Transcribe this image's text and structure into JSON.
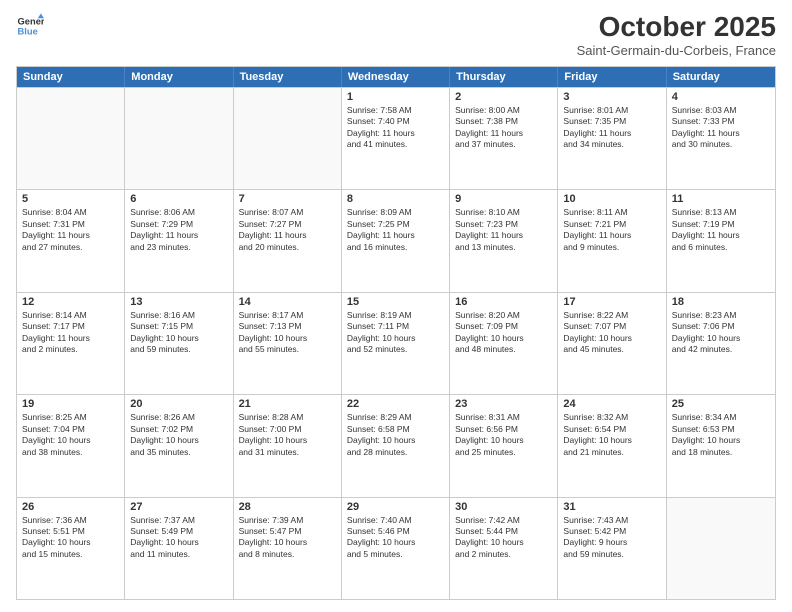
{
  "header": {
    "logo_line1": "General",
    "logo_line2": "Blue",
    "month": "October 2025",
    "location": "Saint-Germain-du-Corbeis, France"
  },
  "weekdays": [
    "Sunday",
    "Monday",
    "Tuesday",
    "Wednesday",
    "Thursday",
    "Friday",
    "Saturday"
  ],
  "rows": [
    [
      {
        "day": "",
        "text": ""
      },
      {
        "day": "",
        "text": ""
      },
      {
        "day": "",
        "text": ""
      },
      {
        "day": "1",
        "text": "Sunrise: 7:58 AM\nSunset: 7:40 PM\nDaylight: 11 hours\nand 41 minutes."
      },
      {
        "day": "2",
        "text": "Sunrise: 8:00 AM\nSunset: 7:38 PM\nDaylight: 11 hours\nand 37 minutes."
      },
      {
        "day": "3",
        "text": "Sunrise: 8:01 AM\nSunset: 7:35 PM\nDaylight: 11 hours\nand 34 minutes."
      },
      {
        "day": "4",
        "text": "Sunrise: 8:03 AM\nSunset: 7:33 PM\nDaylight: 11 hours\nand 30 minutes."
      }
    ],
    [
      {
        "day": "5",
        "text": "Sunrise: 8:04 AM\nSunset: 7:31 PM\nDaylight: 11 hours\nand 27 minutes."
      },
      {
        "day": "6",
        "text": "Sunrise: 8:06 AM\nSunset: 7:29 PM\nDaylight: 11 hours\nand 23 minutes."
      },
      {
        "day": "7",
        "text": "Sunrise: 8:07 AM\nSunset: 7:27 PM\nDaylight: 11 hours\nand 20 minutes."
      },
      {
        "day": "8",
        "text": "Sunrise: 8:09 AM\nSunset: 7:25 PM\nDaylight: 11 hours\nand 16 minutes."
      },
      {
        "day": "9",
        "text": "Sunrise: 8:10 AM\nSunset: 7:23 PM\nDaylight: 11 hours\nand 13 minutes."
      },
      {
        "day": "10",
        "text": "Sunrise: 8:11 AM\nSunset: 7:21 PM\nDaylight: 11 hours\nand 9 minutes."
      },
      {
        "day": "11",
        "text": "Sunrise: 8:13 AM\nSunset: 7:19 PM\nDaylight: 11 hours\nand 6 minutes."
      }
    ],
    [
      {
        "day": "12",
        "text": "Sunrise: 8:14 AM\nSunset: 7:17 PM\nDaylight: 11 hours\nand 2 minutes."
      },
      {
        "day": "13",
        "text": "Sunrise: 8:16 AM\nSunset: 7:15 PM\nDaylight: 10 hours\nand 59 minutes."
      },
      {
        "day": "14",
        "text": "Sunrise: 8:17 AM\nSunset: 7:13 PM\nDaylight: 10 hours\nand 55 minutes."
      },
      {
        "day": "15",
        "text": "Sunrise: 8:19 AM\nSunset: 7:11 PM\nDaylight: 10 hours\nand 52 minutes."
      },
      {
        "day": "16",
        "text": "Sunrise: 8:20 AM\nSunset: 7:09 PM\nDaylight: 10 hours\nand 48 minutes."
      },
      {
        "day": "17",
        "text": "Sunrise: 8:22 AM\nSunset: 7:07 PM\nDaylight: 10 hours\nand 45 minutes."
      },
      {
        "day": "18",
        "text": "Sunrise: 8:23 AM\nSunset: 7:06 PM\nDaylight: 10 hours\nand 42 minutes."
      }
    ],
    [
      {
        "day": "19",
        "text": "Sunrise: 8:25 AM\nSunset: 7:04 PM\nDaylight: 10 hours\nand 38 minutes."
      },
      {
        "day": "20",
        "text": "Sunrise: 8:26 AM\nSunset: 7:02 PM\nDaylight: 10 hours\nand 35 minutes."
      },
      {
        "day": "21",
        "text": "Sunrise: 8:28 AM\nSunset: 7:00 PM\nDaylight: 10 hours\nand 31 minutes."
      },
      {
        "day": "22",
        "text": "Sunrise: 8:29 AM\nSunset: 6:58 PM\nDaylight: 10 hours\nand 28 minutes."
      },
      {
        "day": "23",
        "text": "Sunrise: 8:31 AM\nSunset: 6:56 PM\nDaylight: 10 hours\nand 25 minutes."
      },
      {
        "day": "24",
        "text": "Sunrise: 8:32 AM\nSunset: 6:54 PM\nDaylight: 10 hours\nand 21 minutes."
      },
      {
        "day": "25",
        "text": "Sunrise: 8:34 AM\nSunset: 6:53 PM\nDaylight: 10 hours\nand 18 minutes."
      }
    ],
    [
      {
        "day": "26",
        "text": "Sunrise: 7:36 AM\nSunset: 5:51 PM\nDaylight: 10 hours\nand 15 minutes."
      },
      {
        "day": "27",
        "text": "Sunrise: 7:37 AM\nSunset: 5:49 PM\nDaylight: 10 hours\nand 11 minutes."
      },
      {
        "day": "28",
        "text": "Sunrise: 7:39 AM\nSunset: 5:47 PM\nDaylight: 10 hours\nand 8 minutes."
      },
      {
        "day": "29",
        "text": "Sunrise: 7:40 AM\nSunset: 5:46 PM\nDaylight: 10 hours\nand 5 minutes."
      },
      {
        "day": "30",
        "text": "Sunrise: 7:42 AM\nSunset: 5:44 PM\nDaylight: 10 hours\nand 2 minutes."
      },
      {
        "day": "31",
        "text": "Sunrise: 7:43 AM\nSunset: 5:42 PM\nDaylight: 9 hours\nand 59 minutes."
      },
      {
        "day": "",
        "text": ""
      }
    ]
  ]
}
